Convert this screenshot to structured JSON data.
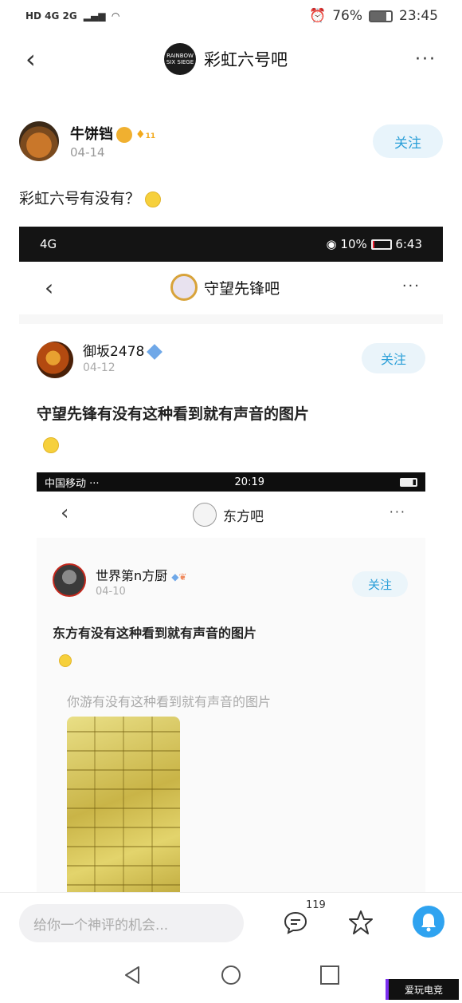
{
  "status_bar": {
    "left": "HD 4G 2G",
    "alarm": "⏰",
    "battery": "76%",
    "time": "23:45"
  },
  "nav": {
    "back": "‹",
    "forum_logo_text": "RAINBOW SIX SIEGE",
    "title": "彩虹六号吧",
    "more": "···"
  },
  "post": {
    "author": "牛饼铛",
    "level": "11",
    "date": "04-14",
    "follow_label": "关注",
    "text": "彩虹六号有没有？"
  },
  "shot1": {
    "status_left": "4G",
    "status_battery": "10%",
    "status_time": "6:43",
    "back": "‹",
    "title": "守望先锋吧",
    "more": "···",
    "author": "御坂2478",
    "date": "04-12",
    "follow_label": "关注",
    "text": "守望先锋有没有这种看到就有声音的图片"
  },
  "shot2": {
    "status_left": "中国移动 ···",
    "status_time": "20:19",
    "back": "‹",
    "title": "东方吧",
    "more": "···",
    "author": "世界第n方厨",
    "date": "04-10",
    "follow_label": "关注",
    "text": "东方有没有这种看到就有声音的图片",
    "subcaption": "你游有没有这种看到就有声音的图片"
  },
  "comment_bar": {
    "placeholder": "给你一个神评的机会...",
    "comment_count": "119"
  },
  "watermark": "爱玩电竞",
  "colors": {
    "accent": "#2b9fd8",
    "follow_bg": "#e8f4fb",
    "bell": "#2fa3f0"
  }
}
